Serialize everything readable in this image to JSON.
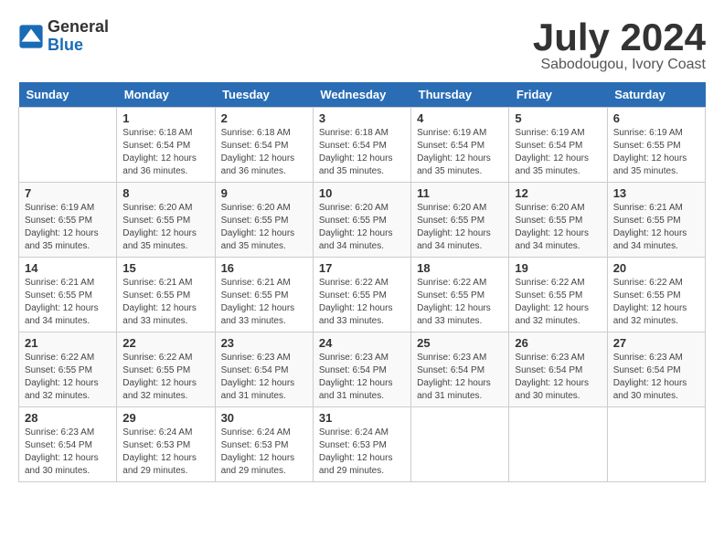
{
  "header": {
    "logo_general": "General",
    "logo_blue": "Blue",
    "title": "July 2024",
    "location": "Sabodougou, Ivory Coast"
  },
  "days_of_week": [
    "Sunday",
    "Monday",
    "Tuesday",
    "Wednesday",
    "Thursday",
    "Friday",
    "Saturday"
  ],
  "weeks": [
    [
      {
        "day": "",
        "info": ""
      },
      {
        "day": "1",
        "info": "Sunrise: 6:18 AM\nSunset: 6:54 PM\nDaylight: 12 hours\nand 36 minutes."
      },
      {
        "day": "2",
        "info": "Sunrise: 6:18 AM\nSunset: 6:54 PM\nDaylight: 12 hours\nand 36 minutes."
      },
      {
        "day": "3",
        "info": "Sunrise: 6:18 AM\nSunset: 6:54 PM\nDaylight: 12 hours\nand 35 minutes."
      },
      {
        "day": "4",
        "info": "Sunrise: 6:19 AM\nSunset: 6:54 PM\nDaylight: 12 hours\nand 35 minutes."
      },
      {
        "day": "5",
        "info": "Sunrise: 6:19 AM\nSunset: 6:54 PM\nDaylight: 12 hours\nand 35 minutes."
      },
      {
        "day": "6",
        "info": "Sunrise: 6:19 AM\nSunset: 6:55 PM\nDaylight: 12 hours\nand 35 minutes."
      }
    ],
    [
      {
        "day": "7",
        "info": "Sunrise: 6:19 AM\nSunset: 6:55 PM\nDaylight: 12 hours\nand 35 minutes."
      },
      {
        "day": "8",
        "info": "Sunrise: 6:20 AM\nSunset: 6:55 PM\nDaylight: 12 hours\nand 35 minutes."
      },
      {
        "day": "9",
        "info": "Sunrise: 6:20 AM\nSunset: 6:55 PM\nDaylight: 12 hours\nand 35 minutes."
      },
      {
        "day": "10",
        "info": "Sunrise: 6:20 AM\nSunset: 6:55 PM\nDaylight: 12 hours\nand 34 minutes."
      },
      {
        "day": "11",
        "info": "Sunrise: 6:20 AM\nSunset: 6:55 PM\nDaylight: 12 hours\nand 34 minutes."
      },
      {
        "day": "12",
        "info": "Sunrise: 6:20 AM\nSunset: 6:55 PM\nDaylight: 12 hours\nand 34 minutes."
      },
      {
        "day": "13",
        "info": "Sunrise: 6:21 AM\nSunset: 6:55 PM\nDaylight: 12 hours\nand 34 minutes."
      }
    ],
    [
      {
        "day": "14",
        "info": "Sunrise: 6:21 AM\nSunset: 6:55 PM\nDaylight: 12 hours\nand 34 minutes."
      },
      {
        "day": "15",
        "info": "Sunrise: 6:21 AM\nSunset: 6:55 PM\nDaylight: 12 hours\nand 33 minutes."
      },
      {
        "day": "16",
        "info": "Sunrise: 6:21 AM\nSunset: 6:55 PM\nDaylight: 12 hours\nand 33 minutes."
      },
      {
        "day": "17",
        "info": "Sunrise: 6:22 AM\nSunset: 6:55 PM\nDaylight: 12 hours\nand 33 minutes."
      },
      {
        "day": "18",
        "info": "Sunrise: 6:22 AM\nSunset: 6:55 PM\nDaylight: 12 hours\nand 33 minutes."
      },
      {
        "day": "19",
        "info": "Sunrise: 6:22 AM\nSunset: 6:55 PM\nDaylight: 12 hours\nand 32 minutes."
      },
      {
        "day": "20",
        "info": "Sunrise: 6:22 AM\nSunset: 6:55 PM\nDaylight: 12 hours\nand 32 minutes."
      }
    ],
    [
      {
        "day": "21",
        "info": "Sunrise: 6:22 AM\nSunset: 6:55 PM\nDaylight: 12 hours\nand 32 minutes."
      },
      {
        "day": "22",
        "info": "Sunrise: 6:22 AM\nSunset: 6:55 PM\nDaylight: 12 hours\nand 32 minutes."
      },
      {
        "day": "23",
        "info": "Sunrise: 6:23 AM\nSunset: 6:54 PM\nDaylight: 12 hours\nand 31 minutes."
      },
      {
        "day": "24",
        "info": "Sunrise: 6:23 AM\nSunset: 6:54 PM\nDaylight: 12 hours\nand 31 minutes."
      },
      {
        "day": "25",
        "info": "Sunrise: 6:23 AM\nSunset: 6:54 PM\nDaylight: 12 hours\nand 31 minutes."
      },
      {
        "day": "26",
        "info": "Sunrise: 6:23 AM\nSunset: 6:54 PM\nDaylight: 12 hours\nand 30 minutes."
      },
      {
        "day": "27",
        "info": "Sunrise: 6:23 AM\nSunset: 6:54 PM\nDaylight: 12 hours\nand 30 minutes."
      }
    ],
    [
      {
        "day": "28",
        "info": "Sunrise: 6:23 AM\nSunset: 6:54 PM\nDaylight: 12 hours\nand 30 minutes."
      },
      {
        "day": "29",
        "info": "Sunrise: 6:24 AM\nSunset: 6:53 PM\nDaylight: 12 hours\nand 29 minutes."
      },
      {
        "day": "30",
        "info": "Sunrise: 6:24 AM\nSunset: 6:53 PM\nDaylight: 12 hours\nand 29 minutes."
      },
      {
        "day": "31",
        "info": "Sunrise: 6:24 AM\nSunset: 6:53 PM\nDaylight: 12 hours\nand 29 minutes."
      },
      {
        "day": "",
        "info": ""
      },
      {
        "day": "",
        "info": ""
      },
      {
        "day": "",
        "info": ""
      }
    ]
  ]
}
